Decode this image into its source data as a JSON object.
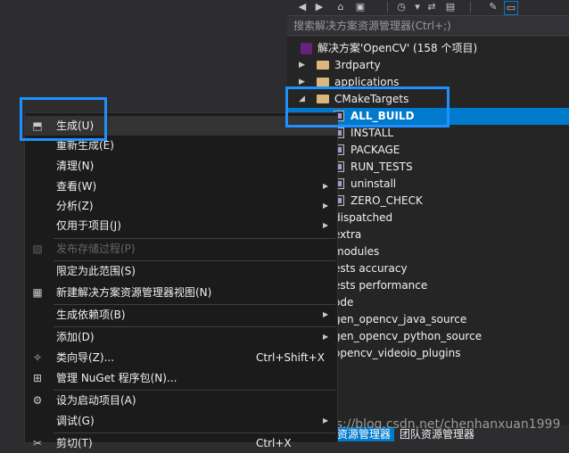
{
  "solution_explorer": {
    "search_placeholder": "搜索解决方案资源管理器(Ctrl+;)",
    "solution_label": "解决方案'OpenCV' (158 个项目)",
    "folders": [
      "3rdparty",
      "applications",
      "CMakeTargets"
    ],
    "targets": [
      "ALL_BUILD",
      "INSTALL",
      "PACKAGE",
      "RUN_TESTS",
      "uninstall",
      "ZERO_CHECK"
    ],
    "more_items": [
      "dispatched",
      "extra",
      "modules",
      "ests accuracy",
      "ests performance",
      "ode",
      "gen_opencv_java_source",
      "gen_opencv_python_source",
      "opencv_videoio_plugins"
    ],
    "selected_item": "ALL_BUILD",
    "bottom_tabs": [
      "资源管理器",
      "团队资源管理器"
    ]
  },
  "context_menu": {
    "items": [
      {
        "label": "生成(U)",
        "icon": "build-icon"
      },
      {
        "label": "重新生成(E)"
      },
      {
        "label": "清理(N)"
      },
      {
        "label": "查看(W)",
        "submenu": true
      },
      {
        "label": "分析(Z)",
        "submenu": true
      },
      {
        "label": "仅用于项目(J)",
        "submenu": true
      },
      {
        "label": "发布存储过程(P)",
        "disabled": true,
        "icon": "publish-icon"
      },
      {
        "label": "限定为此范围(S)"
      },
      {
        "label": "新建解决方案资源管理器视图(N)",
        "icon": "new-view-icon"
      },
      {
        "label": "生成依赖项(B)",
        "submenu": true
      },
      {
        "label": "添加(D)",
        "submenu": true
      },
      {
        "label": "类向导(Z)...",
        "shortcut": "Ctrl+Shift+X",
        "icon": "class-wizard-icon"
      },
      {
        "label": "管理 NuGet 程序包(N)...",
        "icon": "nuget-icon"
      },
      {
        "label": "设为启动项目(A)",
        "icon": "gear-icon"
      },
      {
        "label": "调试(G)",
        "submenu": true
      },
      {
        "label": "剪切(T)",
        "shortcut": "Ctrl+X",
        "icon": "cut-icon"
      }
    ]
  },
  "watermark": "https://blog.csdn.net/chenhanxuan1999",
  "colors": {
    "accent": "#007acc",
    "callout": "#1e90ff"
  }
}
